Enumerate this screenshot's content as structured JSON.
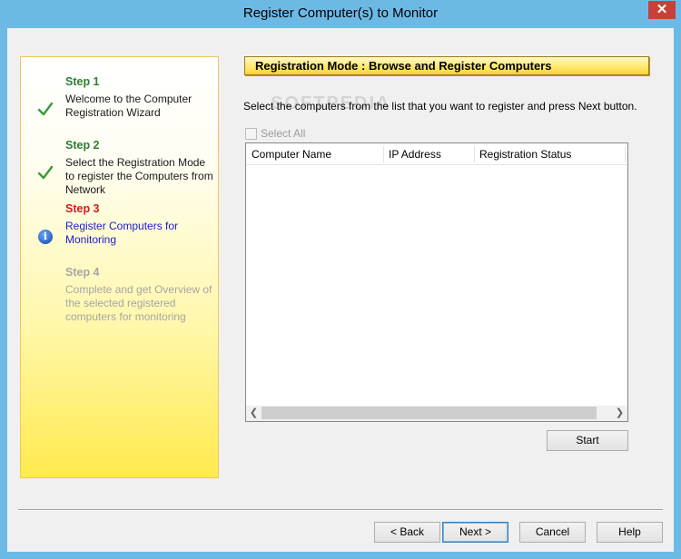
{
  "window": {
    "title": "Register Computer(s) to Monitor",
    "close_symbol": "✕"
  },
  "steps": [
    {
      "title": "Step 1",
      "description": "Welcome to the Computer Registration Wizard",
      "state": "done",
      "icon": "checkmark-icon"
    },
    {
      "title": "Step 2",
      "description": "Select the Registration Mode to register the Computers from Network",
      "state": "done",
      "icon": "checkmark-icon"
    },
    {
      "title": "Step 3",
      "description": "Register Computers for Monitoring",
      "state": "active",
      "icon": "info-icon"
    },
    {
      "title": "Step 4",
      "description": "Complete and get Overview of the selected registered computers for monitoring",
      "state": "pending",
      "icon": ""
    }
  ],
  "main": {
    "heading": "Registration Mode : Browse and Register Computers",
    "instruction": "Select the computers from the list that you want to register and press Next button.",
    "watermark": "SOFTPEDIA",
    "select_all_label": "Select All",
    "select_all_checked": false,
    "select_all_enabled": false,
    "columns": [
      "Computer Name",
      "IP Address",
      "Registration Status"
    ],
    "rows": [],
    "start_label": "Start"
  },
  "footer": {
    "back_label": "< Back",
    "next_label": "Next >",
    "cancel_label": "Cancel",
    "help_label": "Help"
  },
  "colors": {
    "titlebar": "#6cb9e6",
    "step_done": "#2e7d32",
    "step_active_title": "#d11d1d",
    "step_active_text": "#1b1bd4",
    "step_pending": "#a6a6a6",
    "panel_gradient_bottom": "#ffea4d"
  }
}
